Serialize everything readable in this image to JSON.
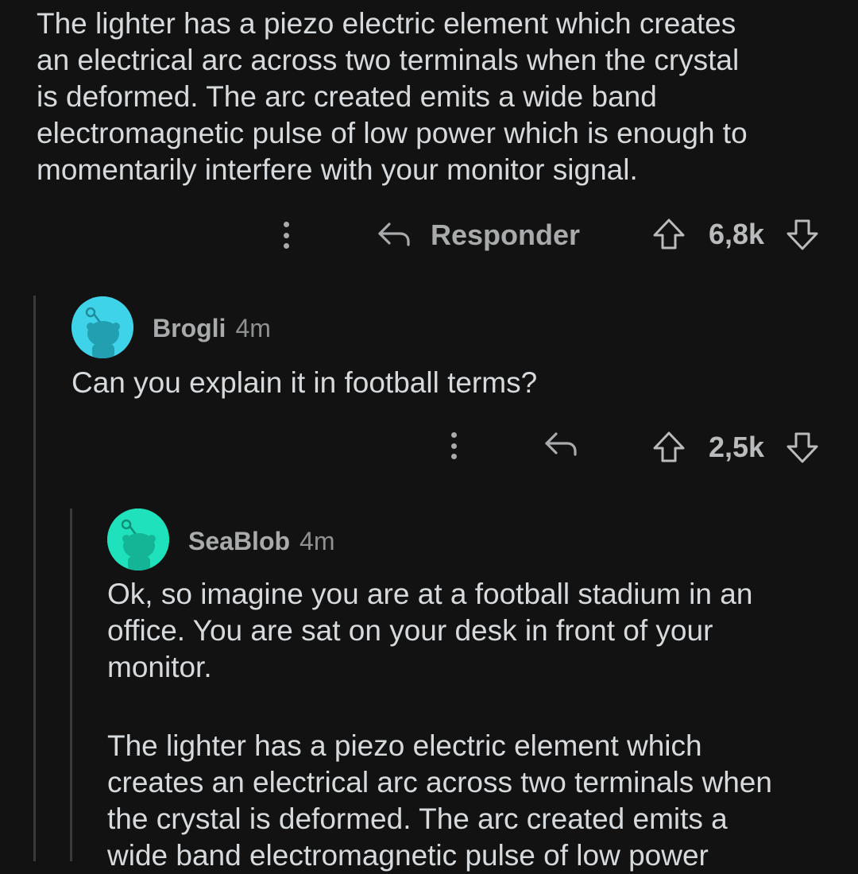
{
  "parent_comment": {
    "text": "The lighter has a piezo electric element which creates\nan electrical arc across two terminals when the crystal\nis deformed.  The arc created emits a wide band\nelectromagnetic pulse of low power which is enough to\nmomentarily interfere with your monitor signal.",
    "reply_label": "Responder",
    "score": "6,8k"
  },
  "reply_1": {
    "username": "Brogli",
    "timestamp": "4m",
    "text": "Can you explain it in football terms?",
    "score": "2,5k",
    "avatar_color": "#3ed3e8"
  },
  "reply_2": {
    "username": "SeaBlob",
    "timestamp": "4m",
    "text_p1": "Ok, so imagine you are at a football stadium in an\noffice. You are sat on your desk in front of your\nmonitor.",
    "text_p2": "The lighter has a piezo electric element which\ncreates an electrical arc across two terminals when\nthe crystal is deformed.  The arc created emits a\nwide band electromagnetic pulse of low power",
    "avatar_color": "#1fe2bd"
  },
  "icons": {
    "more": "more-vertical-icon",
    "reply": "reply-arrow-icon",
    "upvote": "upvote-arrow-icon",
    "downvote": "downvote-arrow-icon",
    "avatar": "snoo-avatar-icon"
  },
  "colors": {
    "background": "#121212",
    "text": "#d7dadc",
    "meta": "#a8aaab",
    "thread_line": "#3a3a3a"
  }
}
